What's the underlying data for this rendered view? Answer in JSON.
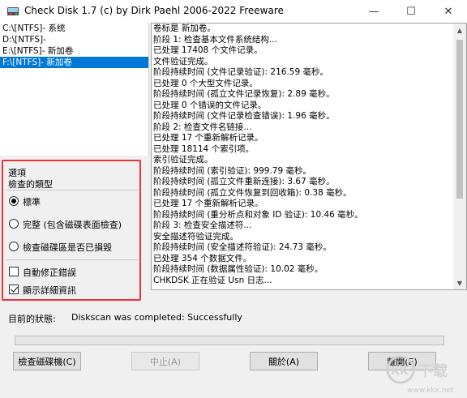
{
  "window": {
    "title": "Check Disk 1.7  (c) by Dirk Paehl  2006-2022 Freeware",
    "minimize_glyph": "—",
    "maximize_glyph": "☐",
    "close_glyph": "✕"
  },
  "drives": [
    {
      "label": "C:\\[NTFS]- 系统",
      "selected": false
    },
    {
      "label": "D:\\[NTFS]-",
      "selected": false
    },
    {
      "label": "E:\\[NTFS]- 新加卷",
      "selected": false
    },
    {
      "label": "F:\\[NTFS]- 新加卷",
      "selected": true
    }
  ],
  "options": {
    "group_title": "選項",
    "check_type_label": "檢查的類型",
    "radio_standard": "標準",
    "radio_full": "完整 (包含磁碟表面檢查)",
    "radio_bad_sectors": "檢查磁碟區是否已損毀",
    "selected_radio": "standard",
    "auto_fix_label": "自動修正錯誤",
    "auto_fix_checked": false,
    "verbose_label": "顯示詳細資訊",
    "verbose_checked": true
  },
  "log_lines": [
    "卷标是 新加卷。",
    "阶段 1: 检查基本文件系统结构...",
    "已处理 17408 个文件记录。",
    "文件验证完成。",
    "阶段持续时间 (文件记录验证): 216.59 毫秒。",
    "已处理 0 个大型文件记录。",
    "阶段持续时间 (孤立文件记录恢复): 2.89 毫秒。",
    "已处理 0 个错误的文件记录。",
    "阶段持续时间 (文件记录检查错误): 1.96 毫秒。",
    "阶段 2: 检查文件名链接...",
    "已处理 17 个重新解析记录。",
    "已处理 18114 个索引项。",
    "索引验证完成。",
    "阶段持续时间 (索引验证): 999.79 毫秒。",
    "阶段持续时间 (孤立文件重新连接): 3.67 毫秒。",
    "阶段持续时间 (孤立文件恢复到回收箱): 0.38 毫秒。",
    "已处理 17 个重新解析记录。",
    "阶段持续时间 (重分析点和对象 ID 验证): 10.46 毫秒。",
    "阶段 3: 检查安全描述符...",
    "安全描述符验证完成。",
    "阶段持续时间 (安全描述符验证): 24.73 毫秒。",
    "已处理 354 个数据文件。",
    "阶段持续时间 (数据属性验证): 10.02 毫秒。",
    "CHKDSK 正在验证 Usn 日志..."
  ],
  "status": {
    "label": "目前的狀態:",
    "value": "Diskscan was completed: Successfully",
    "progress": 0
  },
  "buttons": {
    "check": "檢查磁碟機(C)",
    "abort": "中止(A)",
    "about": "關於(A)",
    "exit": "離開(E)"
  },
  "watermark": {
    "brand": "KK下载",
    "url": "www.kkx.net"
  },
  "colors": {
    "selection": "#0078d7",
    "highlight_frame": "#e8333a"
  }
}
